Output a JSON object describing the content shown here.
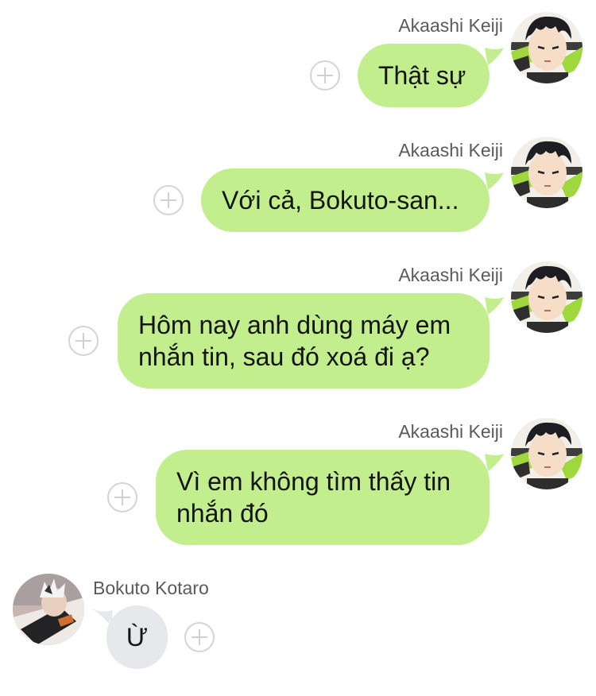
{
  "messages": [
    {
      "sender": "Akaashi Keiji",
      "text": "Thật sự"
    },
    {
      "sender": "Akaashi Keiji",
      "text": "Với cả, Bokuto-san..."
    },
    {
      "sender": "Akaashi Keiji",
      "lines": [
        "Hôm nay anh dùng máy em",
        "nhắn tin, sau đó xoá đi ạ?"
      ]
    },
    {
      "sender": "Akaashi Keiji",
      "lines": [
        "Vì em không tìm thấy tin",
        "nhắn đó"
      ]
    },
    {
      "sender": "Bokuto Kotaro",
      "text": "Ừ"
    }
  ],
  "icons": {
    "plus": "plus-circle-icon",
    "avatar_out": "akaashi-avatar",
    "avatar_in": "bokuto-avatar"
  },
  "colors": {
    "outgoing_bubble": "#c2ee8e",
    "incoming_bubble": "#e6e8ec",
    "name_text": "#5a5a5a"
  }
}
